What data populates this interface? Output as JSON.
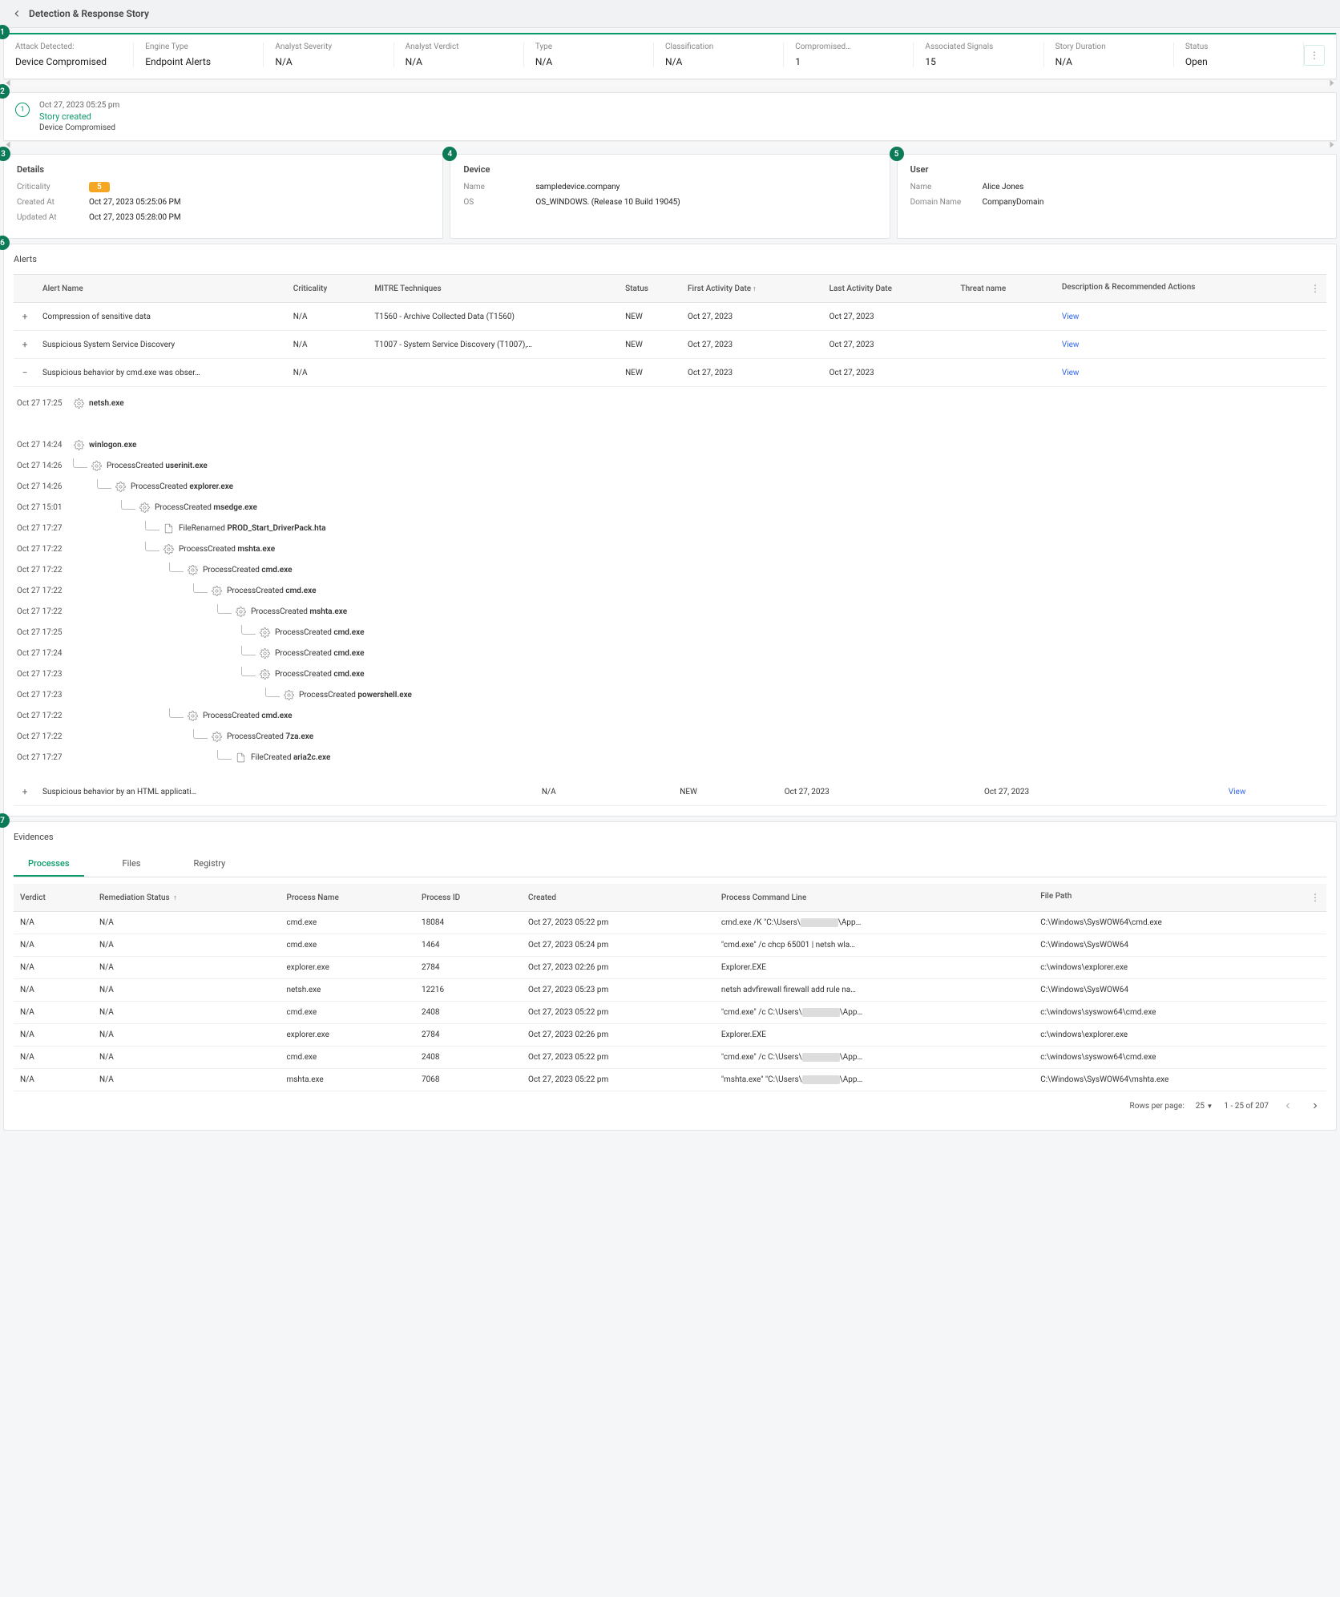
{
  "header": {
    "title": "Detection & Response Story"
  },
  "summary": {
    "cells": [
      {
        "label": "Attack Detected:",
        "value": "Device Compromised"
      },
      {
        "label": "Engine Type",
        "value": "Endpoint Alerts"
      },
      {
        "label": "Analyst Severity",
        "value": "N/A"
      },
      {
        "label": "Analyst Verdict",
        "value": "N/A"
      },
      {
        "label": "Type",
        "value": "N/A"
      },
      {
        "label": "Classification",
        "value": "N/A"
      },
      {
        "label": "Compromised…",
        "value": "1"
      },
      {
        "label": "Associated Signals",
        "value": "15"
      },
      {
        "label": "Story Duration",
        "value": "N/A"
      },
      {
        "label": "Status",
        "value": "Open"
      }
    ]
  },
  "story": {
    "timestamp": "Oct 27, 2023 05:25 pm",
    "title": "Story created",
    "subtitle": "Device Compromised",
    "step": "1"
  },
  "details": {
    "title": "Details",
    "criticality_label": "Criticality",
    "criticality_value": "5",
    "created_label": "Created At",
    "created_value": "Oct 27, 2023 05:25:06 PM",
    "updated_label": "Updated At",
    "updated_value": "Oct 27, 2023 05:28:00 PM"
  },
  "device": {
    "title": "Device",
    "name_label": "Name",
    "name_value": "sampledevice.company",
    "os_label": "OS",
    "os_value": "OS_WINDOWS. (Release 10 Build 19045)"
  },
  "user": {
    "title": "User",
    "name_label": "Name",
    "name_value": "Alice Jones",
    "domain_label": "Domain Name",
    "domain_value": "CompanyDomain"
  },
  "alerts": {
    "title": "Alerts",
    "columns": [
      "",
      "Alert Name",
      "Criticality",
      "MITRE Techniques",
      "Status",
      "First Activity Date",
      "Last Activity Date",
      "Threat name",
      "Description & Recommended Actions"
    ],
    "rows": [
      {
        "exp": "+",
        "name": "Compression of sensitive data",
        "crit": "N/A",
        "mitre": "T1560 - Archive Collected Data (T1560)",
        "status": "NEW",
        "first": "Oct 27, 2023",
        "last": "Oct 27, 2023",
        "threat": "",
        "action": "View"
      },
      {
        "exp": "+",
        "name": "Suspicious System Service Discovery",
        "crit": "N/A",
        "mitre": "T1007 - System Service Discovery (T1007),…",
        "status": "NEW",
        "first": "Oct 27, 2023",
        "last": "Oct 27, 2023",
        "threat": "",
        "action": "View"
      },
      {
        "exp": "−",
        "name": "Suspicious behavior by cmd.exe was obser…",
        "crit": "N/A",
        "mitre": "",
        "status": "NEW",
        "first": "Oct 27, 2023",
        "last": "Oct 27, 2023",
        "threat": "",
        "action": "View"
      },
      {
        "exp": "+",
        "name": "Suspicious behavior by an HTML applicati…",
        "crit": "N/A",
        "mitre": "",
        "status": "NEW",
        "first": "Oct 27, 2023",
        "last": "Oct 27, 2023",
        "threat": "",
        "action": "View"
      }
    ]
  },
  "tree": [
    {
      "ts": "Oct 27 17:25",
      "depth": 0,
      "icon": "gear",
      "prefix": "",
      "name": "netsh.exe",
      "bold": true
    },
    {
      "ts": "",
      "depth": 0,
      "spacer": true
    },
    {
      "ts": "Oct 27 14:24",
      "depth": 0,
      "icon": "gear",
      "prefix": "",
      "name": "winlogon.exe",
      "bold": true
    },
    {
      "ts": "Oct 27 14:26",
      "depth": 1,
      "icon": "gear",
      "prefix": "ProcessCreated ",
      "name": "userinit.exe",
      "bold": true
    },
    {
      "ts": "Oct 27 14:26",
      "depth": 2,
      "icon": "gear",
      "prefix": "ProcessCreated ",
      "name": "explorer.exe",
      "bold": true
    },
    {
      "ts": "Oct 27 15:01",
      "depth": 3,
      "icon": "gear",
      "prefix": "ProcessCreated ",
      "name": "msedge.exe",
      "bold": true
    },
    {
      "ts": "Oct 27 17:27",
      "depth": 4,
      "icon": "doc",
      "prefix": "FileRenamed ",
      "name": "PROD_Start_DriverPack.hta",
      "bold": true
    },
    {
      "ts": "Oct 27 17:22",
      "depth": 4,
      "icon": "gear",
      "prefix": "ProcessCreated ",
      "name": "mshta.exe",
      "bold": true,
      "downline": true
    },
    {
      "ts": "Oct 27 17:22",
      "depth": 5,
      "icon": "gear",
      "prefix": "ProcessCreated ",
      "name": "cmd.exe",
      "bold": true
    },
    {
      "ts": "Oct 27 17:22",
      "depth": 6,
      "icon": "gear",
      "prefix": "ProcessCreated ",
      "name": "cmd.exe",
      "bold": true
    },
    {
      "ts": "Oct 27 17:22",
      "depth": 7,
      "icon": "gear",
      "prefix": "ProcessCreated ",
      "name": "mshta.exe",
      "bold": true
    },
    {
      "ts": "Oct 27 17:25",
      "depth": 8,
      "icon": "gear",
      "prefix": "ProcessCreated ",
      "name": "cmd.exe",
      "bold": true
    },
    {
      "ts": "Oct 27 17:24",
      "depth": 8,
      "icon": "gear",
      "prefix": "ProcessCreated ",
      "name": "cmd.exe",
      "bold": true
    },
    {
      "ts": "Oct 27 17:23",
      "depth": 8,
      "icon": "gear",
      "prefix": "ProcessCreated ",
      "name": "cmd.exe",
      "bold": true
    },
    {
      "ts": "Oct 27 17:23",
      "depth": 9,
      "icon": "gear",
      "prefix": "ProcessCreated ",
      "name": "powershell.exe",
      "bold": true
    },
    {
      "ts": "Oct 27 17:22",
      "depth": 5,
      "icon": "gear",
      "prefix": "ProcessCreated ",
      "name": "cmd.exe",
      "bold": true
    },
    {
      "ts": "Oct 27 17:22",
      "depth": 6,
      "icon": "gear",
      "prefix": "ProcessCreated ",
      "name": "7za.exe",
      "bold": true
    },
    {
      "ts": "Oct 27 17:27",
      "depth": 7,
      "icon": "doc",
      "prefix": "FileCreated ",
      "name": "aria2c.exe",
      "bold": true
    }
  ],
  "evidences": {
    "title": "Evidences",
    "tabs": [
      "Processes",
      "Files",
      "Registry"
    ],
    "active_tab": 0,
    "columns": [
      "Verdict",
      "Remediation Status",
      "Process Name",
      "Process ID",
      "Created",
      "Process Command Line",
      "File Path"
    ],
    "rows": [
      {
        "verdict": "N/A",
        "rem": "N/A",
        "pname": "cmd.exe",
        "pid": "18084",
        "created": "Oct 27, 2023 05:22 pm",
        "cmd": "cmd.exe /K \"C:\\Users\\███\\App…",
        "path": "C:\\Windows\\SysWOW64\\cmd.exe"
      },
      {
        "verdict": "N/A",
        "rem": "N/A",
        "pname": "cmd.exe",
        "pid": "1464",
        "created": "Oct 27, 2023 05:24 pm",
        "cmd": "\"cmd.exe\" /c chcp 65001 | netsh wla…",
        "path": "C:\\Windows\\SysWOW64"
      },
      {
        "verdict": "N/A",
        "rem": "N/A",
        "pname": "explorer.exe",
        "pid": "2784",
        "created": "Oct 27, 2023 02:26 pm",
        "cmd": "Explorer.EXE",
        "path": "c:\\windows\\explorer.exe"
      },
      {
        "verdict": "N/A",
        "rem": "N/A",
        "pname": "netsh.exe",
        "pid": "12216",
        "created": "Oct 27, 2023 05:23 pm",
        "cmd": "netsh advfirewall firewall add rule na…",
        "path": "C:\\Windows\\SysWOW64"
      },
      {
        "verdict": "N/A",
        "rem": "N/A",
        "pname": "cmd.exe",
        "pid": "2408",
        "created": "Oct 27, 2023 05:22 pm",
        "cmd": "\"cmd.exe\" /c C:\\Users\\███\\App…",
        "path": "c:\\windows\\syswow64\\cmd.exe"
      },
      {
        "verdict": "N/A",
        "rem": "N/A",
        "pname": "explorer.exe",
        "pid": "2784",
        "created": "Oct 27, 2023 02:26 pm",
        "cmd": "Explorer.EXE",
        "path": "c:\\windows\\explorer.exe"
      },
      {
        "verdict": "N/A",
        "rem": "N/A",
        "pname": "cmd.exe",
        "pid": "2408",
        "created": "Oct 27, 2023 05:22 pm",
        "cmd": "\"cmd.exe\" /c C:\\Users\\███\\App…",
        "path": "c:\\windows\\syswow64\\cmd.exe"
      },
      {
        "verdict": "N/A",
        "rem": "N/A",
        "pname": "mshta.exe",
        "pid": "7068",
        "created": "Oct 27, 2023 05:22 pm",
        "cmd": "\"mshta.exe\" \"C:\\Users\\███\\App…",
        "path": "C:\\Windows\\SysWOW64\\mshta.exe"
      }
    ],
    "pager": {
      "rows_per_page_label": "Rows per page:",
      "rows_per_page": "25",
      "range": "1 - 25 of 207"
    }
  }
}
